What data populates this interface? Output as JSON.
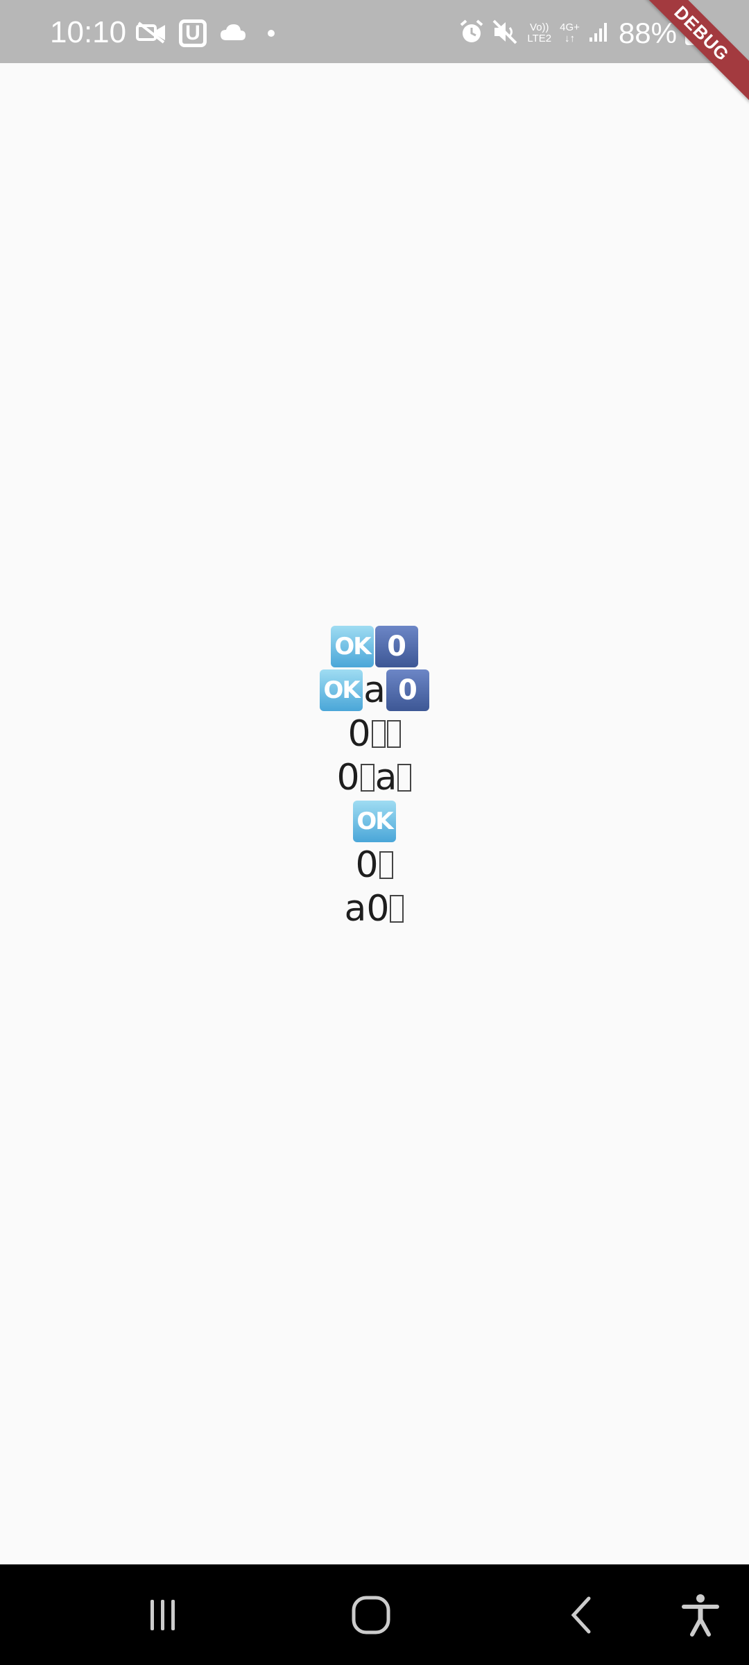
{
  "status_bar": {
    "time": "10:10",
    "u_badge": "U",
    "volte_top": "Vo))",
    "volte_bottom": "LTE2",
    "network_top": "4G+",
    "network_bottom": "↓↑",
    "battery": "88%",
    "icons_left": [
      "video-camera-icon",
      "u-app-icon",
      "cloud-icon",
      "notification-dot-icon"
    ],
    "icons_right": [
      "alarm-icon",
      "mute-icon",
      "volte-icon",
      "network-4g-icon",
      "signal-icon",
      "battery-charging-icon"
    ]
  },
  "debug_banner": {
    "label": "DEBUG",
    "color": "#a33a3f"
  },
  "content": {
    "line1": {
      "ok_badge": "OK",
      "zero_badge": "0"
    },
    "line2": {
      "ok_badge": "OK",
      "text": "a",
      "zero_badge": "0"
    },
    "line3": {
      "text": "0"
    },
    "line4": {
      "text_start": "0",
      "text_mid": "a"
    },
    "line5": {
      "ok_badge": "OK"
    },
    "line6": {
      "text": "0"
    },
    "line7": {
      "text": "a0"
    },
    "ok_badge_color": "#4aa6d8",
    "zero_badge_color": "#3d5795"
  },
  "nav_bar": {
    "items": [
      "recent-apps-icon",
      "home-icon",
      "back-icon",
      "accessibility-icon"
    ]
  }
}
